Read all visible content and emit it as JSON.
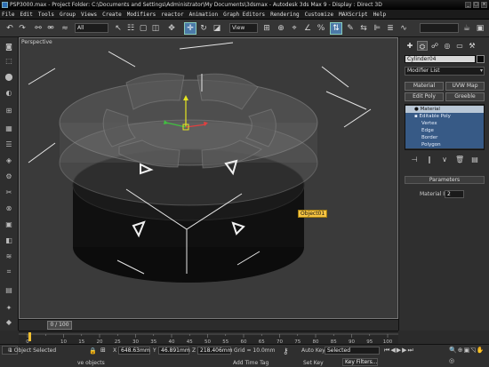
{
  "window": {
    "title": "PSP3000.max - Project Folder: C:\\Documents and Settings\\Administrator\\My Documents\\3dsmax - Autodesk 3ds Max 9 - Display : Direct 3D"
  },
  "menu": [
    "File",
    "Edit",
    "Tools",
    "Group",
    "Views",
    "Create",
    "Modifiers",
    "reactor",
    "Animation",
    "Graph Editors",
    "Rendering",
    "Customize",
    "MAXScript",
    "Help"
  ],
  "toolbar": {
    "selection_filter": "All",
    "ref_coord": "View"
  },
  "viewport": {
    "label": "Perspective",
    "object_tag": "Object01"
  },
  "command_panel": {
    "object_name": "Cylinder04",
    "modifier_list": "Modifier List",
    "buttons": [
      "Material",
      "UVW Map",
      "Edit Poly",
      "Greeble"
    ],
    "stack": [
      "Material",
      "Editable Poly",
      "Vertex",
      "Edge",
      "Border",
      "Polygon"
    ],
    "rollout_title": "Parameters",
    "material_id_label": "Material ID:",
    "material_id_value": "2"
  },
  "time": {
    "slider_label": "0 / 100",
    "ticks": [
      "0",
      "10",
      "15",
      "20",
      "25",
      "30",
      "35",
      "40",
      "45",
      "50",
      "55",
      "60",
      "65",
      "70",
      "75",
      "80",
      "85",
      "90",
      "95",
      "100"
    ]
  },
  "status": {
    "selected": "1 Object Selected",
    "prompt": "ve objects",
    "x_label": "X",
    "x": "648.63mm",
    "y_label": "Y",
    "y": "46.891mm",
    "z_label": "Z",
    "z": "218.406mm",
    "grid": "Grid = 10.0mm",
    "add_time_tag": "Add Time Tag",
    "auto_key": "Auto Key",
    "set_key": "Set Key",
    "selected_dd": "Selected",
    "key_filters": "Key Filters..."
  }
}
